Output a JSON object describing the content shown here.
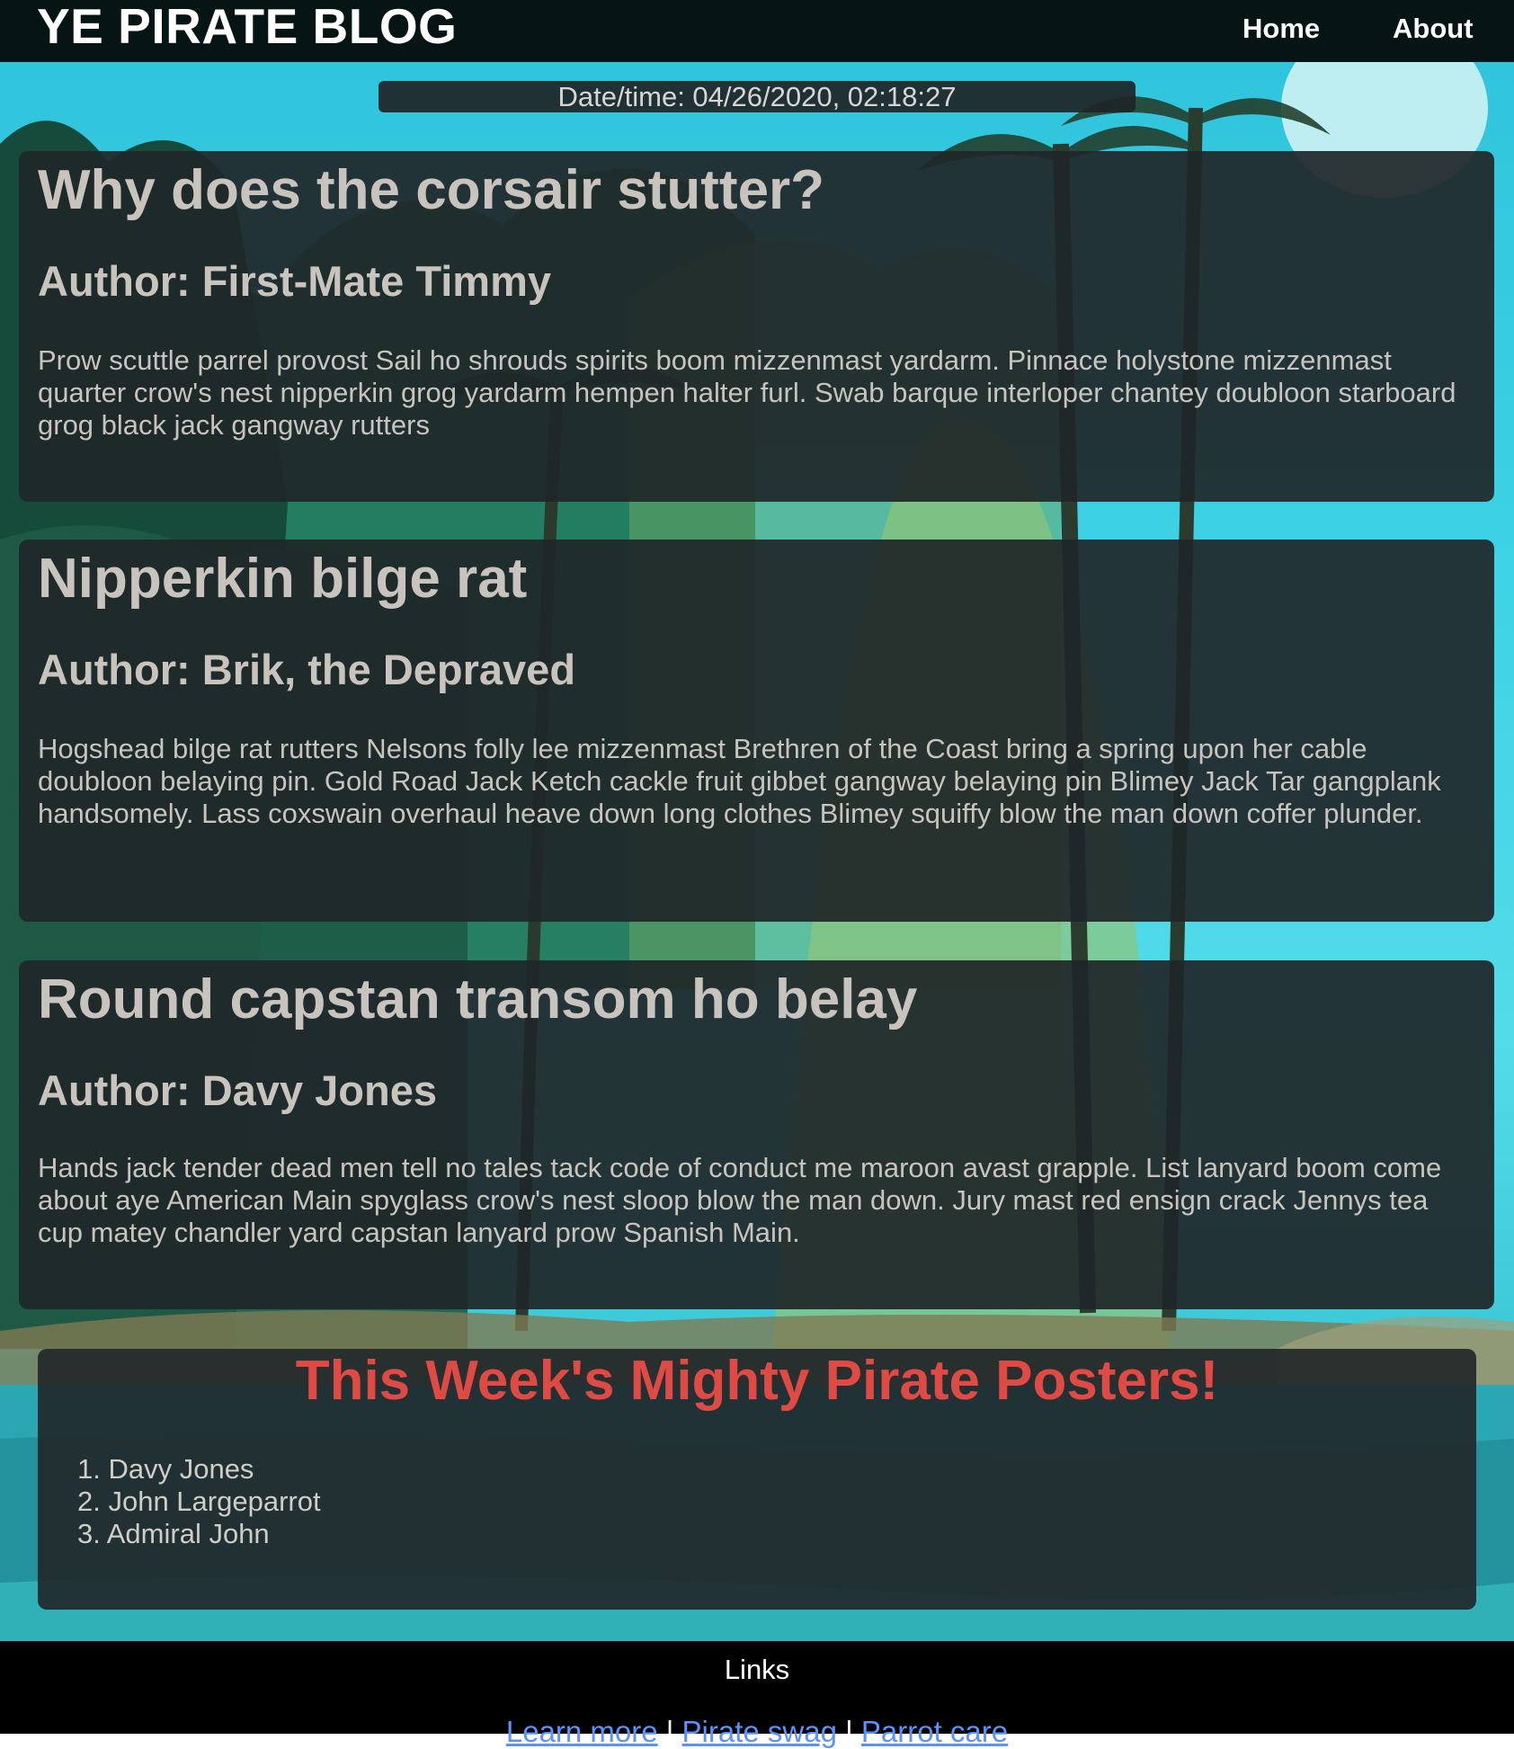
{
  "header": {
    "site_title": "YE PIRATE BLOG",
    "nav": [
      {
        "label": "Home"
      },
      {
        "label": "About"
      }
    ]
  },
  "datetime": {
    "text": "Date/time: 04/26/2020, 02:18:27"
  },
  "posts": [
    {
      "title": "Why does the corsair stutter?",
      "author": "Author: First-Mate Timmy",
      "body": "Prow scuttle parrel provost Sail ho shrouds spirits boom mizzenmast yardarm. Pinnace holystone mizzenmast quarter crow's nest nipperkin grog yardarm hempen halter furl. Swab barque interloper chantey doubloon starboard grog black jack gangway rutters"
    },
    {
      "title": "Nipperkin bilge rat",
      "author": "Author: Brik, the Depraved",
      "body": "Hogshead bilge rat rutters Nelsons folly lee mizzenmast Brethren of the Coast bring a spring upon her cable doubloon belaying pin. Gold Road Jack Ketch cackle fruit gibbet gangway belaying pin Blimey Jack Tar gangplank handsomely. Lass coxswain overhaul heave down long clothes Blimey squiffy blow the man down coffer plunder."
    },
    {
      "title": "Round capstan transom ho belay",
      "author": "Author: Davy Jones",
      "body": "Hands jack tender dead men tell no tales tack code of conduct me maroon avast grapple. List lanyard boom come about aye American Main spyglass crow's nest sloop blow the man down. Jury mast red ensign crack Jennys tea cup matey chandler yard capstan lanyard prow Spanish Main."
    }
  ],
  "posters": {
    "title": "This Week's Mighty Pirate Posters!",
    "items": [
      "1. Davy Jones",
      "2. John Largeparrot",
      "3. Admiral John"
    ]
  },
  "footer": {
    "heading": "Links",
    "links": [
      {
        "label": "Learn more"
      },
      {
        "label": "Pirate swag"
      },
      {
        "label": "Parrot care"
      }
    ],
    "separator": "|"
  },
  "colors": {
    "header_bg": "#071414",
    "panel_bg": "#202628",
    "posters_title": "#e04a44",
    "link": "#5a93ff",
    "sky": "#3fd3e6"
  }
}
